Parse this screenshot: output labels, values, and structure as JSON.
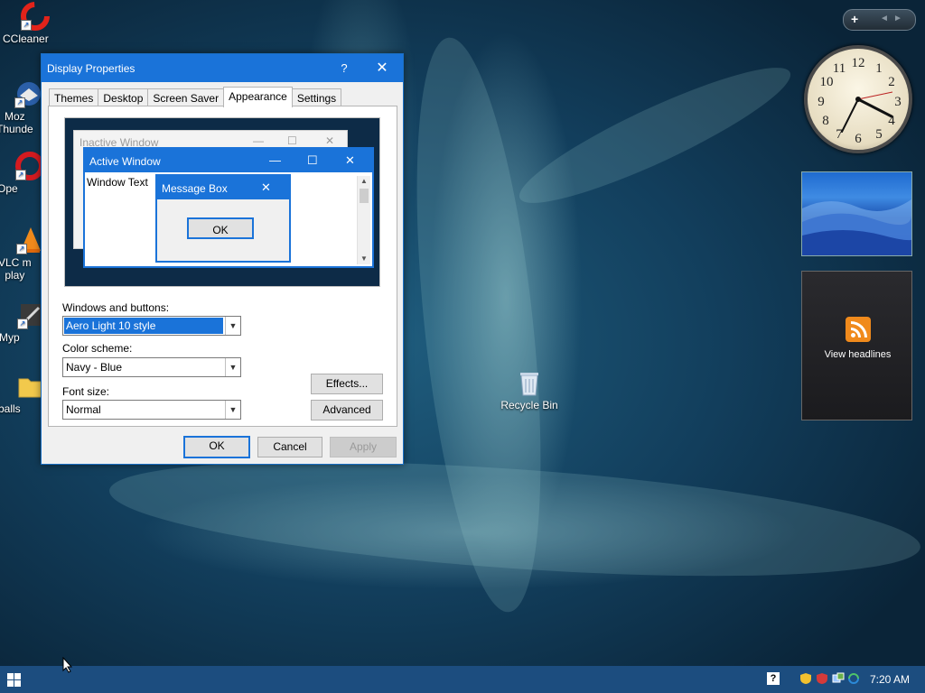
{
  "desktop": {
    "icons": [
      {
        "label": "CCleaner"
      },
      {
        "label": "Moz\nThunde"
      },
      {
        "label": "Ope"
      },
      {
        "label": "VLC m\nplay"
      },
      {
        "label": "Myp"
      },
      {
        "label": "balls"
      }
    ],
    "recycle_bin": "Recycle Bin"
  },
  "window": {
    "title": "Display Properties",
    "help": "?",
    "close": "✕",
    "tabs": [
      "Themes",
      "Desktop",
      "Screen Saver",
      "Appearance",
      "Settings"
    ],
    "active_tab": "Appearance",
    "preview": {
      "inactive_title": "Inactive Window",
      "active_title": "Active Window",
      "window_text": "Window Text",
      "message_title": "Message Box",
      "ok": "OK",
      "min": "—",
      "max": "☐",
      "close": "✕"
    },
    "windows_buttons_label": "Windows and buttons:",
    "windows_buttons_value": "Aero Light 10 style",
    "color_scheme_label": "Color scheme:",
    "color_scheme_value": "Navy - Blue",
    "font_size_label": "Font size:",
    "font_size_value": "Normal",
    "effects": "Effects...",
    "advanced": "Advanced",
    "ok": "OK",
    "cancel": "Cancel",
    "apply": "Apply"
  },
  "gadgets": {
    "bar_plus": "+",
    "bar_left": "◄",
    "bar_right": "►",
    "clock_numbers": [
      "12",
      "1",
      "2",
      "3",
      "4",
      "5",
      "6",
      "7",
      "8",
      "9",
      "10",
      "11"
    ],
    "feed_text": "View headlines"
  },
  "taskbar": {
    "time": "7:20 AM",
    "help": "?"
  },
  "colors": {
    "accent": "#1a73d9",
    "taskbar": "#1c4d7f"
  }
}
